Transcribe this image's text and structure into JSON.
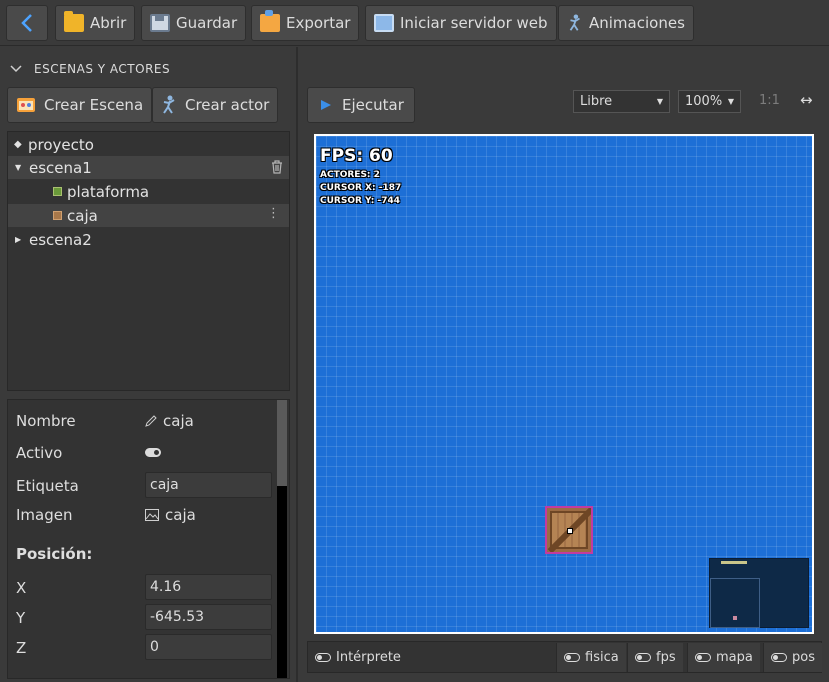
{
  "toolbar": {
    "back_icon": "chevron-left-icon",
    "open_label": "Abrir",
    "save_label": "Guardar",
    "export_label": "Exportar",
    "server_label": "Iniciar servidor web",
    "animations_label": "Animaciones"
  },
  "sidebar": {
    "section_title": "ESCENAS Y ACTORES",
    "create_scene_label": "Crear Escena",
    "create_actor_label": "Crear actor",
    "tree": {
      "project": "proyecto",
      "scene1": "escena1",
      "actor1": "plataforma",
      "actor2": "caja",
      "scene2": "escena2"
    }
  },
  "properties": {
    "name_label": "Nombre",
    "name_value": "caja",
    "active_label": "Activo",
    "active_value": true,
    "tag_label": "Etiqueta",
    "tag_value": "caja",
    "image_label": "Imagen",
    "image_value": "caja",
    "position_title": "Posición:",
    "x_label": "X",
    "x_value": "4.16",
    "y_label": "Y",
    "y_value": "-645.53",
    "z_label": "Z",
    "z_value": "0"
  },
  "main": {
    "run_label": "Ejecutar",
    "mode_select": "Libre",
    "zoom_select": "100%",
    "ratio_label": "1:1",
    "expand_icon": "left-right-arrow-icon"
  },
  "hud": {
    "fps": "FPS: 60",
    "actors": "ACTORES: 2",
    "cursor_x": "CURSOR X: -187",
    "cursor_y": "CURSOR Y: -744"
  },
  "statusbar": {
    "interpreter": "Intérprete",
    "physics": "fisica",
    "fps": "fps",
    "map": "mapa",
    "pos": "pos"
  },
  "colors": {
    "canvas_bg": "#1d6fd6",
    "selection_border": "#c23ba0",
    "accent": "#3b8fe8"
  }
}
